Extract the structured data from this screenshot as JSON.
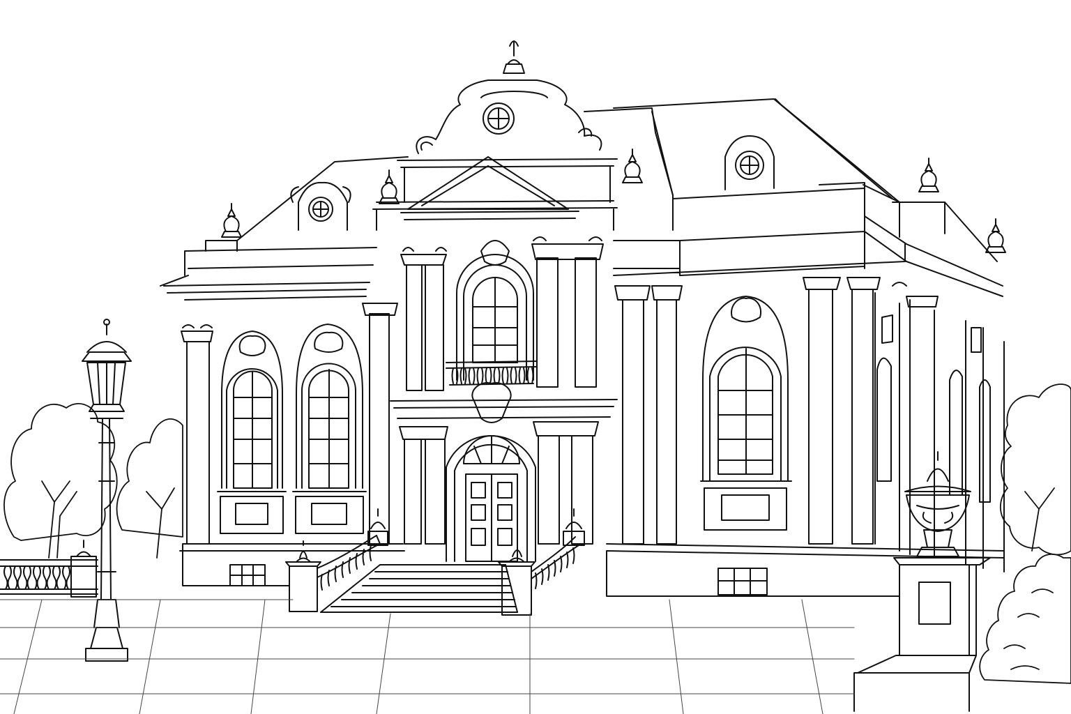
{
  "palette": {
    "ink": "#111111",
    "paper": "#ffffff",
    "glass": "#ffffff"
  },
  "scene": {
    "subject": "baroque-building-line-drawing",
    "style": "coloring-page-outline",
    "elements": [
      "building",
      "mansard-roof",
      "central-pediment",
      "dormers",
      "urn-finials",
      "arched-windows",
      "double-door",
      "grand-staircase",
      "street-lamp",
      "trees",
      "balustrade",
      "planter-urn",
      "paved-plaza"
    ]
  }
}
